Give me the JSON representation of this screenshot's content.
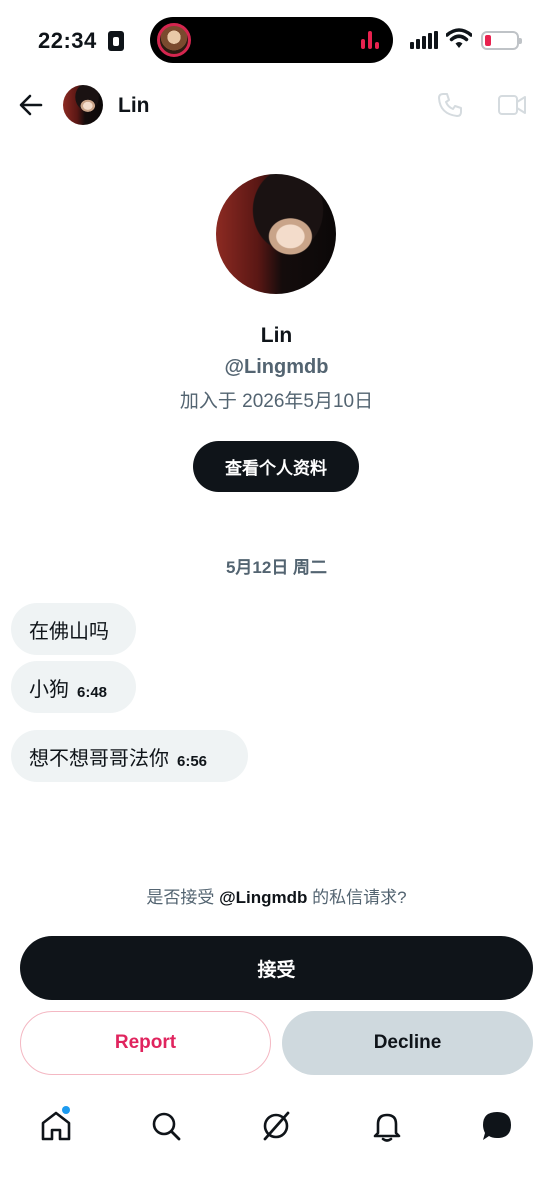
{
  "status_bar": {
    "time": "22:34"
  },
  "header": {
    "name": "Lin"
  },
  "profile": {
    "name": "Lin",
    "handle": "@Lingmdb",
    "joined": "加入于 2026年5月10日",
    "view_profile_label": "查看个人资料"
  },
  "conversation": {
    "date": "5月12日 周二",
    "messages": [
      {
        "text": "在佛山吗",
        "time": ""
      },
      {
        "text": "小狗",
        "time": "6:48"
      },
      {
        "text": "想不想哥哥法你",
        "time": "6:56"
      }
    ]
  },
  "request": {
    "prefix": "是否接受 ",
    "handle": "@Lingmdb",
    "suffix": " 的私信请求?",
    "accept_label": "接受",
    "report_label": "Report",
    "decline_label": "Decline"
  },
  "tabbar": {
    "items": [
      "home-icon",
      "search-icon",
      "grok-icon",
      "bell-icon",
      "messages-icon"
    ]
  },
  "colors": {
    "text": "#0f1419",
    "secondary": "#536471",
    "bubble": "#eff3f4",
    "report": "#e0245e",
    "decline_bg": "#cfd9de",
    "notification_dot": "#1d9bf0"
  }
}
